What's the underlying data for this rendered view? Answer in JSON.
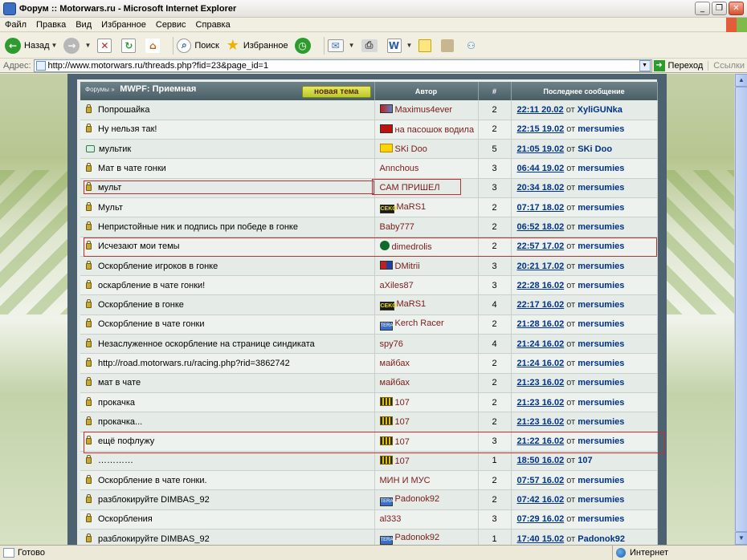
{
  "window": {
    "title": "Форум :: Motorwars.ru - Microsoft Internet Explorer",
    "buttons": [
      "_",
      "❐",
      "✕"
    ]
  },
  "menu": [
    "Файл",
    "Правка",
    "Вид",
    "Избранное",
    "Сервис",
    "Справка"
  ],
  "toolbar": {
    "back": "Назад",
    "search": "Поиск",
    "favorites": "Избранное"
  },
  "address": {
    "label": "Адрес:",
    "url": "http://www.motorwars.ru/threads.php?fid=23&page_id=1",
    "go": "Переход",
    "links": "Ссылки"
  },
  "forum": {
    "crumb": "Форумы »",
    "title": "MWPF: Приемная",
    "new_topic": "новая тема",
    "col_author": "Автор",
    "col_count": "#",
    "col_last": "Последнее сообщение",
    "from_word": "от",
    "rows": [
      {
        "icon": "lock-icon",
        "title": "Попрошайка",
        "badge": "car",
        "author": "Maximus4ever",
        "count": "2",
        "date": "22:11 20.02",
        "by": "XyliGUNka"
      },
      {
        "icon": "lock-icon",
        "title": "Ну нельзя так!",
        "badge": "red",
        "author": "на пасошок водила",
        "count": "2",
        "date": "22:15 19.02",
        "by": "mersumies"
      },
      {
        "icon": "bubble-icon",
        "title": "мультик",
        "badge": "heart",
        "author": "SKi Doo",
        "count": "5",
        "date": "21:05 19.02",
        "by": "SKi Doo"
      },
      {
        "icon": "lock-icon",
        "title": "Мат в чате гонки",
        "badge": "",
        "author": "Annchous",
        "count": "3",
        "date": "06:44 19.02",
        "by": "mersumies"
      },
      {
        "icon": "lock-icon",
        "title": "мульт",
        "badge": "",
        "author": "САМ ПРИШЕЛ",
        "count": "3",
        "date": "20:34 18.02",
        "by": "mersumies"
      },
      {
        "icon": "lock-icon",
        "title": "Мульт",
        "badge": "ceko",
        "author": "MaRS1",
        "count": "2",
        "date": "07:17 18.02",
        "by": "mersumies"
      },
      {
        "icon": "lock-icon",
        "title": "Непристойные ник и подпись при победе в гонке",
        "badge": "",
        "author": "Baby777",
        "count": "2",
        "date": "06:52 18.02",
        "by": "mersumies"
      },
      {
        "icon": "lock-icon",
        "title": "Исчезают мои темы",
        "badge": "ball",
        "author": "dimedrolis",
        "count": "2",
        "date": "22:57 17.02",
        "by": "mersumies"
      },
      {
        "icon": "lock-icon",
        "title": "Оскорбление игроков в гонке",
        "badge": "dmitrii",
        "author": "DMitrii",
        "count": "3",
        "date": "20:21 17.02",
        "by": "mersumies"
      },
      {
        "icon": "lock-icon",
        "title": "оскарбление в чате гонки!",
        "badge": "",
        "author": "aXiles87",
        "count": "3",
        "date": "22:28 16.02",
        "by": "mersumies"
      },
      {
        "icon": "lock-icon",
        "title": "Оскорбление в гонке",
        "badge": "ceko",
        "author": "MaRS1",
        "count": "4",
        "date": "22:17 16.02",
        "by": "mersumies"
      },
      {
        "icon": "lock-icon",
        "title": "Оскорбление в чате гонки",
        "badge": "tera",
        "author": "Kerch Racer",
        "count": "2",
        "date": "21:28 16.02",
        "by": "mersumies"
      },
      {
        "icon": "lock-icon",
        "title": "Незаслуженное оскорбление на странице синдиката",
        "badge": "",
        "author": "spy76",
        "count": "4",
        "date": "21:24 16.02",
        "by": "mersumies"
      },
      {
        "icon": "lock-icon",
        "title": "http://road.motorwars.ru/racing.php?rid=3862742",
        "badge": "",
        "author": "майбах",
        "count": "2",
        "date": "21:24 16.02",
        "by": "mersumies"
      },
      {
        "icon": "lock-icon",
        "title": "мат в чате",
        "badge": "",
        "author": "майбах",
        "count": "2",
        "date": "21:23 16.02",
        "by": "mersumies"
      },
      {
        "icon": "lock-icon",
        "title": "прокачка",
        "badge": "crown",
        "author": "107",
        "count": "2",
        "date": "21:23 16.02",
        "by": "mersumies"
      },
      {
        "icon": "lock-icon",
        "title": "прокачка...",
        "badge": "crown",
        "author": "107",
        "count": "2",
        "date": "21:23 16.02",
        "by": "mersumies"
      },
      {
        "icon": "lock-icon",
        "title": "ещё пофлужу",
        "badge": "crown",
        "author": "107",
        "count": "3",
        "date": "21:22 16.02",
        "by": "mersumies"
      },
      {
        "icon": "lock-icon",
        "title": "…………",
        "badge": "crown",
        "author": "107",
        "count": "1",
        "date": "18:50 16.02",
        "by": "107"
      },
      {
        "icon": "lock-icon",
        "title": "Оскорбление в чате гонки.",
        "badge": "",
        "author": "МИН И МУС",
        "count": "2",
        "date": "07:57 16.02",
        "by": "mersumies"
      },
      {
        "icon": "lock-icon",
        "title": "разблокируйте DIMBAS_92",
        "badge": "tera",
        "author": "Padonok92",
        "count": "2",
        "date": "07:42 16.02",
        "by": "mersumies"
      },
      {
        "icon": "lock-icon",
        "title": "Оскорбления",
        "badge": "",
        "author": "al333",
        "count": "3",
        "date": "07:29 16.02",
        "by": "mersumies"
      },
      {
        "icon": "lock-icon",
        "title": "разблокируйте DIMBAS_92",
        "badge": "tera",
        "author": "Padonok92",
        "count": "1",
        "date": "17:40 15.02",
        "by": "Padonok92"
      }
    ]
  },
  "status": {
    "text": "Готово",
    "zone": "Интернет"
  },
  "colors": {
    "header_bg": "#4a5e66",
    "link": "#003388",
    "author": "#7a1a1a",
    "highlight": "#c03030"
  }
}
